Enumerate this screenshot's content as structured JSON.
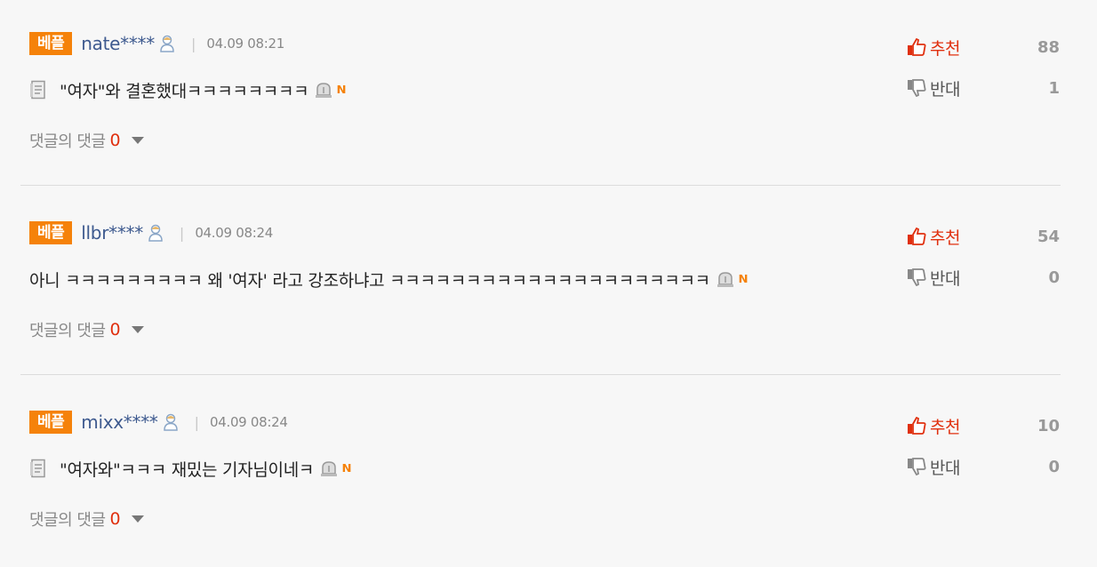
{
  "comments": [
    {
      "badge": "베플",
      "user": "nate****",
      "time": "04.09 08:21",
      "text": "\"여자\"와 결혼했대ㅋㅋㅋㅋㅋㅋㅋㅋ",
      "has_doc_icon": true,
      "reply_label": "댓글의 댓글",
      "reply_count": "0",
      "up_label": "추천",
      "up_count": "88",
      "down_label": "반대",
      "down_count": "1"
    },
    {
      "badge": "베플",
      "user": "llbr****",
      "time": "04.09 08:24",
      "text": "아니 ㅋㅋㅋㅋㅋㅋㅋㅋㅋ 왜 '여자' 라고 강조하냐고 ㅋㅋㅋㅋㅋㅋㅋㅋㅋㅋㅋㅋㅋㅋㅋㅋㅋㅋㅋㅋㅋ",
      "has_doc_icon": false,
      "reply_label": "댓글의 댓글",
      "reply_count": "0",
      "up_label": "추천",
      "up_count": "54",
      "down_label": "반대",
      "down_count": "0"
    },
    {
      "badge": "베플",
      "user": "mixx****",
      "time": "04.09 08:24",
      "text": "\"여자와\"ㅋㅋㅋ 재밌는 기자님이네ㅋ",
      "has_doc_icon": true,
      "reply_label": "댓글의 댓글",
      "reply_count": "0",
      "up_label": "추천",
      "up_count": "10",
      "down_label": "반대",
      "down_count": "0"
    }
  ],
  "divider_char": "|",
  "new_badge": "N",
  "icons": {
    "user": "user-icon",
    "doc": "document-icon",
    "alert": "report-siren-icon",
    "new": "new-badge-icon",
    "caret": "caret-down-icon",
    "up": "thumbs-up-icon",
    "down": "thumbs-down-icon"
  },
  "colors": {
    "badge": "#f5820a",
    "username": "#3e5a8f",
    "accent_red": "#e0300f",
    "background": "#f7f7f7"
  }
}
